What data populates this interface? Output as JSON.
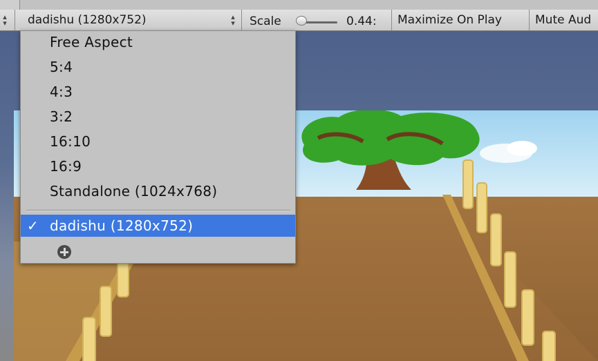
{
  "toolbar": {
    "aspect_selected": "dadishu (1280x752)",
    "scale_label": "Scale",
    "scale_value": "0.44:",
    "maximize_on_play": "Maximize On Play",
    "mute_audio": "Mute Aud"
  },
  "scale_slider": {
    "fraction": 0.0
  },
  "dropdown": {
    "items": [
      {
        "label": "Free Aspect",
        "selected": false
      },
      {
        "label": "5:4",
        "selected": false
      },
      {
        "label": "4:3",
        "selected": false
      },
      {
        "label": "3:2",
        "selected": false
      },
      {
        "label": "16:10",
        "selected": false
      },
      {
        "label": "16:9",
        "selected": false
      },
      {
        "label": "Standalone (1024x768)",
        "selected": false
      },
      {
        "label": "dadishu (1280x752)",
        "selected": true
      }
    ],
    "check_mark": "✓",
    "add_icon": "plus-circle-icon"
  },
  "colors": {
    "toolbar_bg": "#d4d4d4",
    "dropdown_bg": "#c3c3c3",
    "selection_blue": "#3c78e0",
    "ground": "#9a6b38",
    "fence": "#ecd585",
    "sky": "#bfe1f2",
    "tree_green": "#3fae2c",
    "tree_trunk": "#8b4f26"
  }
}
